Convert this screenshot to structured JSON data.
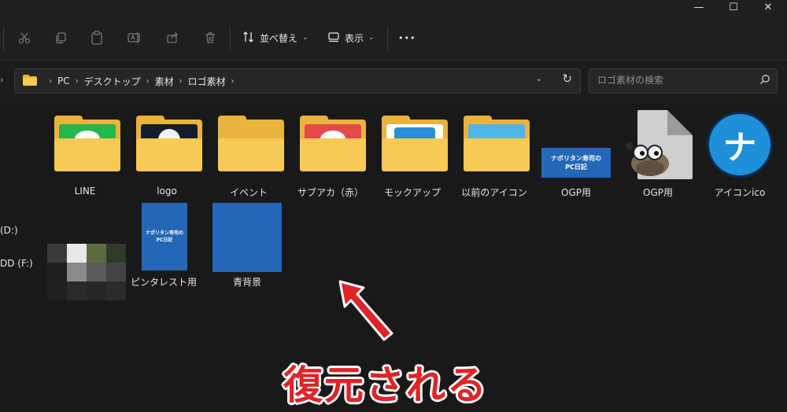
{
  "window": {
    "controls": [
      "—",
      "☐",
      "✕"
    ]
  },
  "toolbar": {
    "icons": [
      "scissors-icon",
      "copy-icon",
      "paste-icon",
      "rename-icon",
      "share-icon",
      "delete-icon"
    ],
    "sort_label": "並べ替え",
    "view_label": "表示",
    "more_label": "•••"
  },
  "address": {
    "segments": [
      "PC",
      "デスクトップ",
      "素材",
      "ロゴ素材"
    ],
    "search_placeholder": "ロゴ素材の検索"
  },
  "sidebar": {
    "drives": [
      "(D:)",
      "DD (F:)"
    ]
  },
  "items": [
    {
      "name": "LINE",
      "thumb_color": "#25b74a"
    },
    {
      "name": "logo",
      "thumb_color": "#141c2e"
    },
    {
      "name": "イベント",
      "thumb_color": "none"
    },
    {
      "name": "サブアカ（赤）",
      "thumb_color": "#e34a4a"
    },
    {
      "name": "モックアップ",
      "thumb_color": "#2a8fd6"
    },
    {
      "name": "以前のアイコン",
      "thumb_color": "#4fb6e8"
    },
    {
      "name": "OGP用",
      "thumb_text": "ナポリタン寿司の\nPC日記"
    },
    {
      "name": "OGP用"
    },
    {
      "name": "アイコンico",
      "icon_glyph": "ナ"
    },
    {
      "name": "ピンタレスト用",
      "thumb_text": "ナポリタン寿司の\nPC日記"
    },
    {
      "name": "青背景"
    }
  ],
  "annotation": {
    "text": "復元される",
    "color": "#e02427"
  },
  "colors": {
    "folder_back": "#e9b43e",
    "folder_front": "#f7ca55",
    "blue_tile": "#2467b6"
  }
}
